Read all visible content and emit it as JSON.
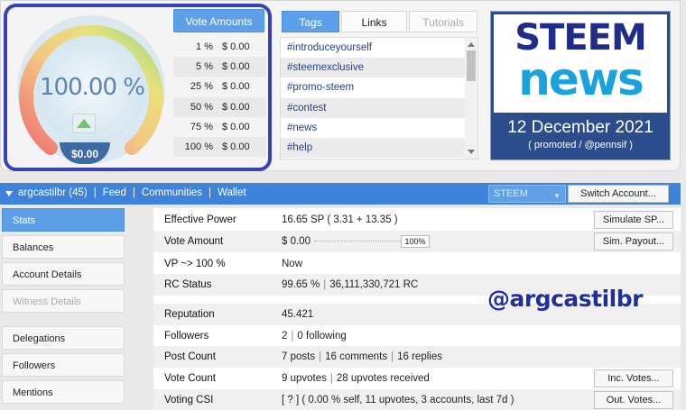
{
  "gauge": {
    "percent_text": "100.00 %",
    "value_text": "$0.00",
    "percent_value": 100
  },
  "vote_amounts": {
    "header": "Vote Amounts",
    "rows": [
      {
        "pct": "1 %",
        "val": "$ 0.00"
      },
      {
        "pct": "5 %",
        "val": "$ 0.00"
      },
      {
        "pct": "25 %",
        "val": "$ 0.00"
      },
      {
        "pct": "50 %",
        "val": "$ 0.00"
      },
      {
        "pct": "75 %",
        "val": "$ 0.00"
      },
      {
        "pct": "100 %",
        "val": "$ 0.00"
      }
    ]
  },
  "tabs": {
    "tags": "Tags",
    "links": "Links",
    "tutorials": "Tutorials"
  },
  "tags": [
    "#introduceyourself",
    "#steemexclusive",
    "#promo-steem",
    "#contest",
    "#news",
    "#help"
  ],
  "news": {
    "line1": "STEEM",
    "line2": "news",
    "date": "12 December 2021",
    "promo": "( promoted / @pennsif )"
  },
  "account_bar": {
    "account": "argcastilbr (45)",
    "links": [
      "Feed",
      "Communities",
      "Wallet"
    ],
    "currency": "STEEM",
    "switch_label": "Switch Account..."
  },
  "sidebar": {
    "items": [
      "Stats",
      "Balances",
      "Account Details",
      "Witness Details",
      "Delegations",
      "Followers",
      "Mentions"
    ]
  },
  "stats": {
    "effective_power": {
      "label": "Effective Power",
      "value": "16.65 SP",
      "detail": "( 3.31 + 13.35 )",
      "button": "Simulate SP..."
    },
    "vote_amount": {
      "label": "Vote Amount",
      "value": "$ 0.00",
      "slider_value": "100%",
      "button": "Sim. Payout..."
    },
    "vp": {
      "label": "VP ~> 100 %",
      "value": "Now"
    },
    "rc_status": {
      "label": "RC Status",
      "value": "99.65 %",
      "detail": "36,111,330,721 RC"
    },
    "reputation": {
      "label": "Reputation",
      "value": "45.421"
    },
    "followers": {
      "label": "Followers",
      "value": "2",
      "detail": "0 following"
    },
    "post_count": {
      "label": "Post Count",
      "value": "7 posts",
      "detail1": "16 comments",
      "detail2": "16 replies"
    },
    "vote_count": {
      "label": "Vote Count",
      "value": "9 upvotes",
      "detail": "28 upvotes received",
      "button": "Inc. Votes..."
    },
    "voting_csi": {
      "label": "Voting CSI",
      "value": "[ ? ] ( 0.00 % self, 11 upvotes, 3 accounts, last 7d )",
      "button": "Out. Votes..."
    }
  },
  "overlay_username": "@argcastilbr",
  "colors": {
    "accent": "#5da0e8",
    "bar": "#3f82dc",
    "frame": "#3a40b8",
    "news_bg": "#2b4d8e"
  }
}
